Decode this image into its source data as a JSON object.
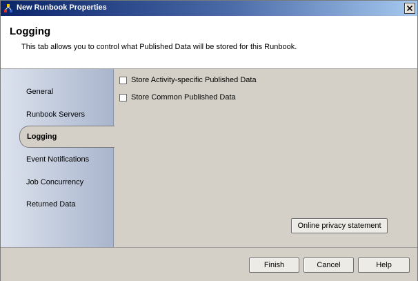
{
  "window": {
    "title": "New Runbook Properties"
  },
  "header": {
    "title": "Logging",
    "description": "This tab allows you to control what Published Data will be stored for this Runbook."
  },
  "nav": {
    "items": [
      {
        "label": "General"
      },
      {
        "label": "Runbook Servers"
      },
      {
        "label": "Logging",
        "selected": true
      },
      {
        "label": "Event Notifications"
      },
      {
        "label": "Job Concurrency"
      },
      {
        "label": "Returned Data"
      }
    ]
  },
  "content": {
    "options": [
      {
        "label": "Store Activity-specific Published Data",
        "checked": false
      },
      {
        "label": "Store Common Published Data",
        "checked": false
      }
    ],
    "privacy_button": "Online privacy statement"
  },
  "footer": {
    "finish": "Finish",
    "cancel": "Cancel",
    "help": "Help"
  }
}
